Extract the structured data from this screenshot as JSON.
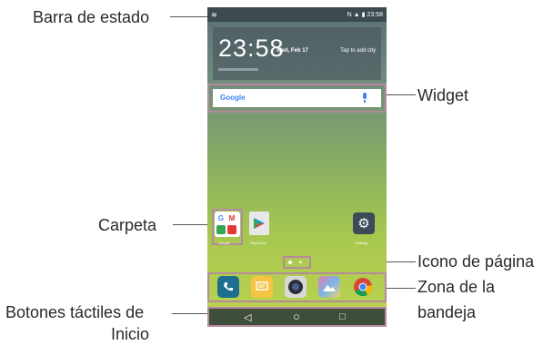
{
  "callouts": {
    "status_bar": "Barra de estado",
    "widget": "Widget",
    "folder": "Carpeta",
    "page_icon": "Icono de página",
    "tray_zone_line1": "Zona de la",
    "tray_zone_line2": "bandeja",
    "home_buttons_line1": "Botones táctiles de",
    "home_buttons_line2": "Inicio"
  },
  "phone": {
    "status_time": "23:58",
    "clock_time": "23:58",
    "clock_date": "Wed, Feb 17",
    "clock_city_hint": "Tap to add city",
    "search_brand": "Google",
    "folder_label": "Google",
    "playstore_label": "Play Store",
    "settings_label": "Settings",
    "folder_glyphs": [
      "G",
      "M",
      "",
      ""
    ],
    "tray_apps": [
      "phone-icon",
      "messaging-icon",
      "camera-icon",
      "gallery-icon",
      "chrome-icon"
    ],
    "nav_buttons": [
      "◁",
      "○",
      "□"
    ]
  },
  "colors": {
    "highlight_outline": "#b58a9e",
    "leader_line": "#555555"
  }
}
